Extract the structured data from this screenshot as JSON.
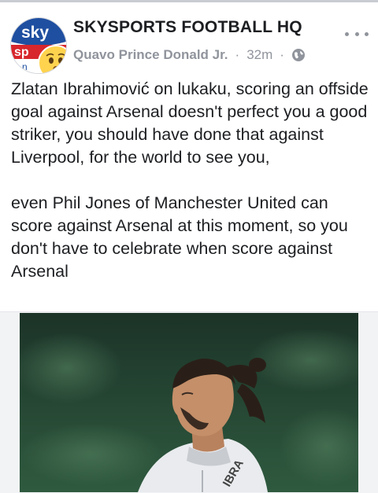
{
  "post": {
    "page_name": "SKYSPORTS FOOTBALL HQ",
    "author": "Quavo Prince Donald Jr.",
    "time": "32m",
    "paragraphs": [
      "Zlatan Ibrahimović  on lukaku, scoring an offside goal against Arsenal doesn't perfect you a good striker, you should have done that against Liverpool, for the world to see you,",
      "even Phil Jones of Manchester United can score against Arsenal at this moment, so you don't have to celebrate when score against Arsenal"
    ]
  },
  "avatar": {
    "logo_top": "sky",
    "logo_bottom": "sp",
    "logo_tail": "n"
  },
  "photo": {
    "jersey_text": "IBRA"
  },
  "icons": {
    "privacy": "globe-icon",
    "more": "more-icon"
  },
  "colors": {
    "logo_blue": "#1f4fa0",
    "logo_red": "#d7262c",
    "meta_gray": "#90949c"
  }
}
